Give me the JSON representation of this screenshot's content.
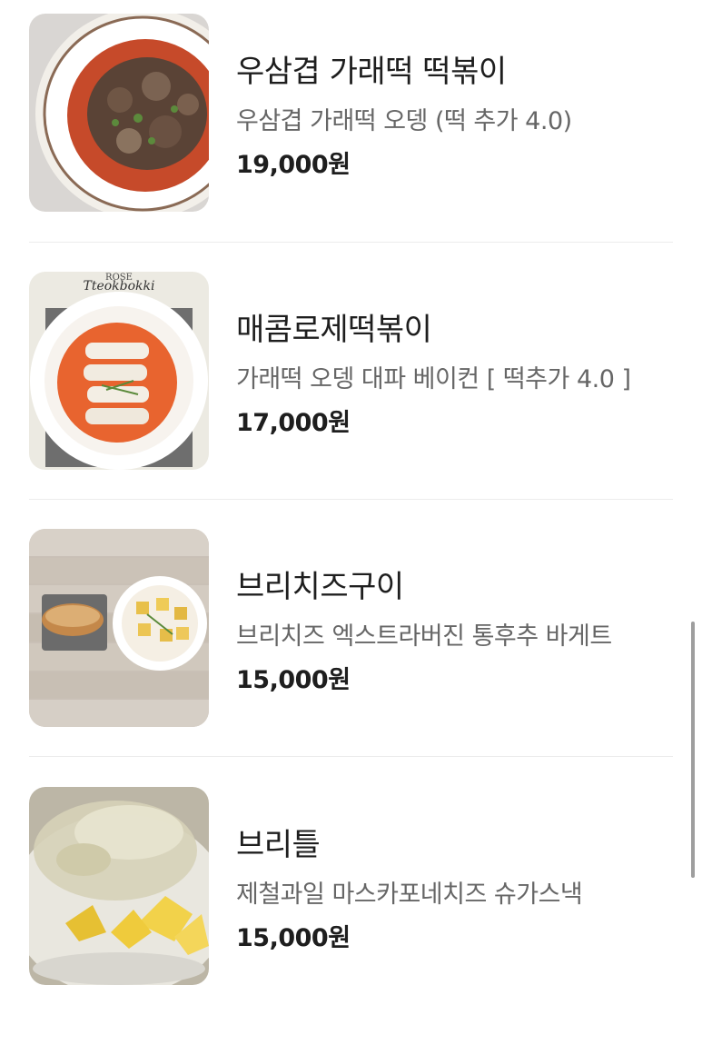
{
  "menu": {
    "items": [
      {
        "name": "우삼겹 가래떡 떡볶이",
        "description": "우삼겹 가래떡 오뎅 (떡 추가 4.0)",
        "price": "19,000원"
      },
      {
        "name": "매콤로제떡볶이",
        "description": "가래떡 오뎅 대파 베이컨 [ 떡추가 4.0 ]",
        "price": "17,000원",
        "image_text": [
          "ROSE",
          "Tteokbokki"
        ]
      },
      {
        "name": "브리치즈구이",
        "description": "브리치즈 엑스트라버진 통후추 바게트",
        "price": "15,000원"
      },
      {
        "name": "브리틀",
        "description": "제철과일 마스카포네치즈 슈가스낵",
        "price": "15,000원"
      }
    ]
  },
  "icons": [
    "food-photo-tteokbokki",
    "food-photo-rose-tteokbokki",
    "food-photo-brie",
    "food-photo-brittle"
  ]
}
